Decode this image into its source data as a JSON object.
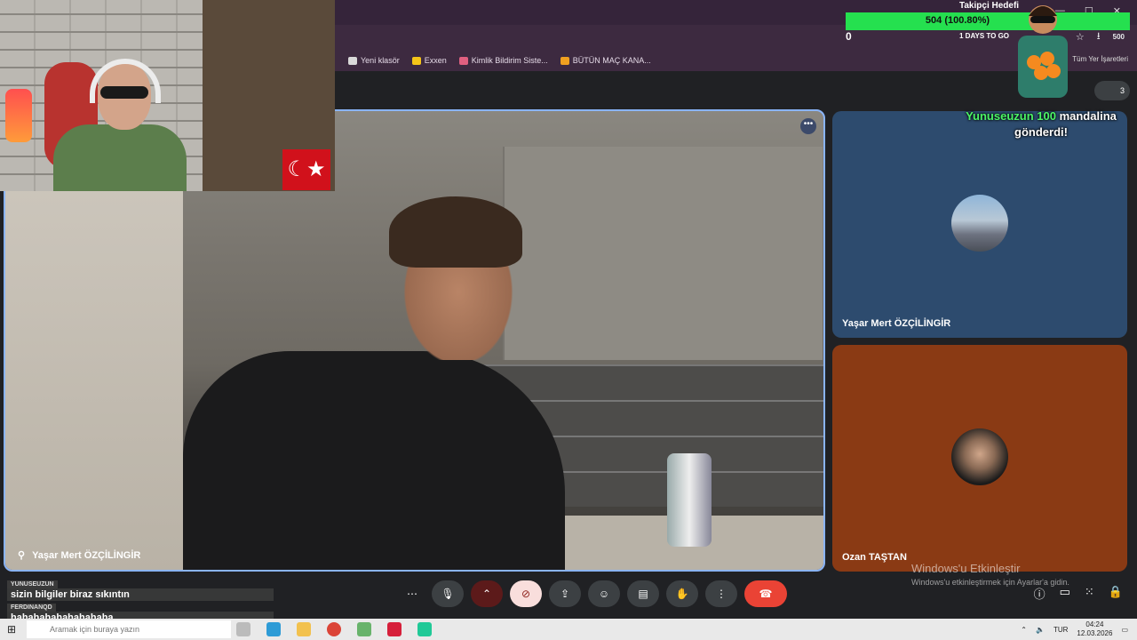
{
  "bookmarks": [
    {
      "label": "Yeni klasör",
      "color": "#d9d9d9"
    },
    {
      "label": "Exxen",
      "color": "#f5c518"
    },
    {
      "label": "Kimlik Bildirim Siste...",
      "color": "#e06080"
    },
    {
      "label": "BÜTÜN MAÇ KANA...",
      "color": "#f0a020"
    }
  ],
  "browser": {
    "all_bookmarks": "Tüm Yer İşaretleri",
    "zero": "0",
    "days_to_go": "1 DAYS TO GO",
    "profile_count": "500"
  },
  "goal": {
    "title": "Takipçi Hedefi",
    "text": "504 (100.80%)",
    "fraction": 1.0
  },
  "donation": {
    "user_amount": "Yunuseuzun 100",
    "line1_rest": " mandalina",
    "line2": "gönderdi!"
  },
  "meet": {
    "main_label": "Yaşar Mert ÖZÇİLİNGİR",
    "tile_a_label": "Yaşar Mert ÖZÇİLİNGİR",
    "tile_b_label": "Ozan TAŞTAN",
    "people_count": "3"
  },
  "chat": [
    {
      "user": "YUNUSEUZUN",
      "message": "sizin bilgiler biraz sıkıntın"
    },
    {
      "user": "FERDINANQD",
      "message": "hahahahahahahahaha"
    }
  ],
  "windows_activation": {
    "title": "Windows'u Etkinleştir",
    "subtitle": "Windows'u etkinleştirmek için Ayarlar'a gidin."
  },
  "taskbar": {
    "search_placeholder": "Aramak için buraya yazın",
    "language": "TUR",
    "time": "04:24",
    "date": "12.03.2026"
  },
  "flag_symbol": "☾★"
}
